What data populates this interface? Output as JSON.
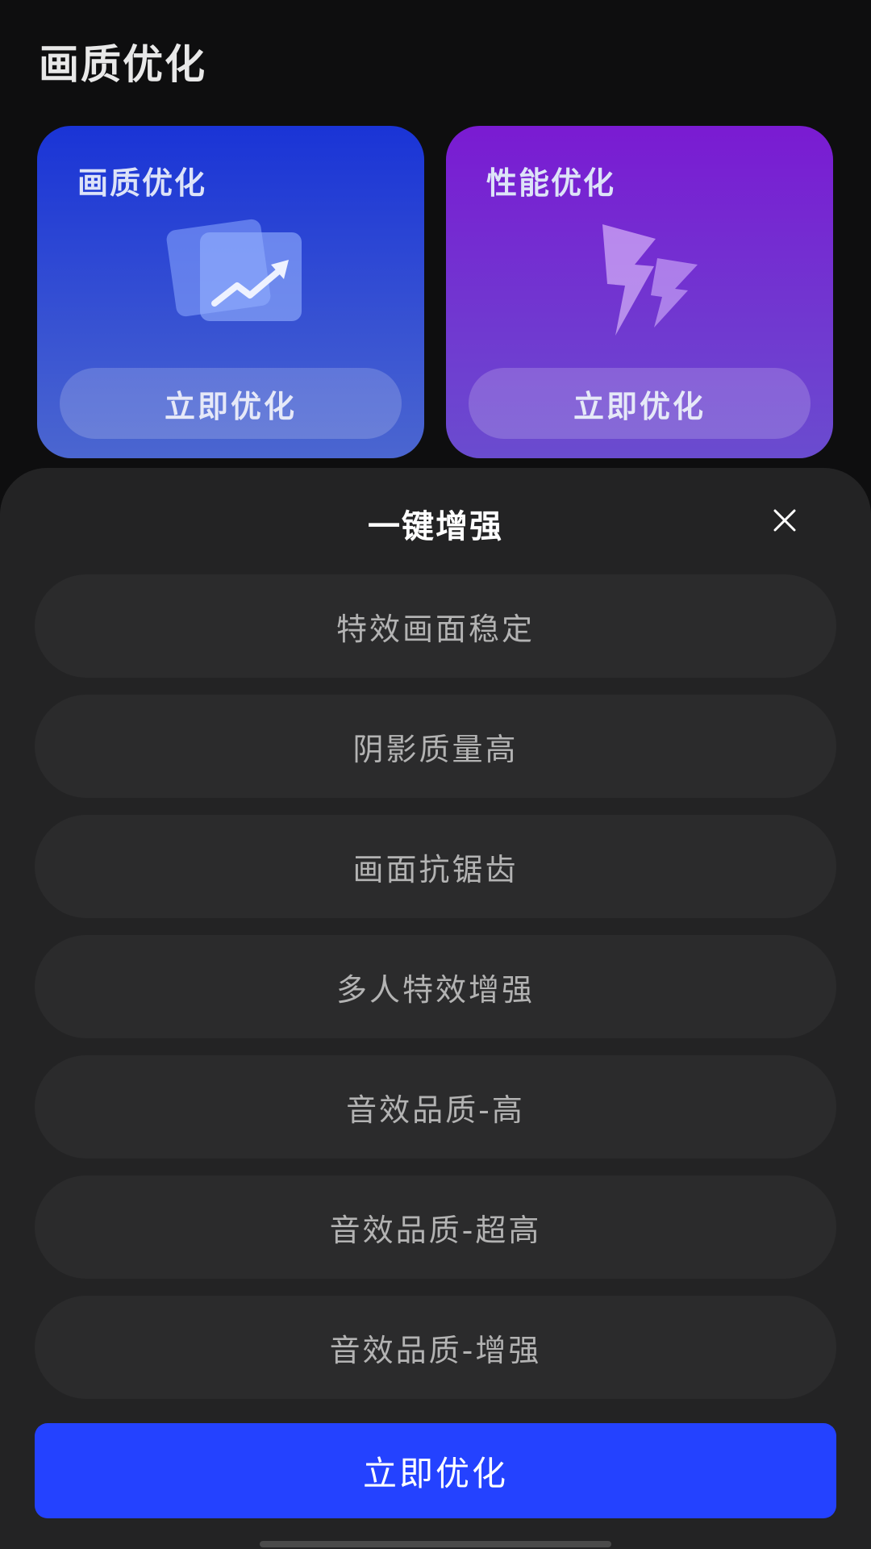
{
  "page": {
    "title": "画质优化"
  },
  "cards": [
    {
      "title": "画质优化",
      "icon": "trend-up-photo-icon",
      "button_label": "立即优化"
    },
    {
      "title": "性能优化",
      "icon": "lightning-bolt-icon",
      "button_label": "立即优化"
    }
  ],
  "sheet": {
    "title": "一键增强",
    "close_icon": "close-icon",
    "options": [
      "特效画面稳定",
      "阴影质量高",
      "画面抗锯齿",
      "多人特效增强",
      "音效品质-高",
      "音效品质-超高",
      "音效品质-增强"
    ],
    "primary_button": "立即优化"
  },
  "colors": {
    "primary": "#2442ff",
    "quality_card": "#1a34d6",
    "performance_card": "#7a1bd2",
    "sheet_bg": "#232324",
    "option_bg": "#2b2b2c"
  }
}
